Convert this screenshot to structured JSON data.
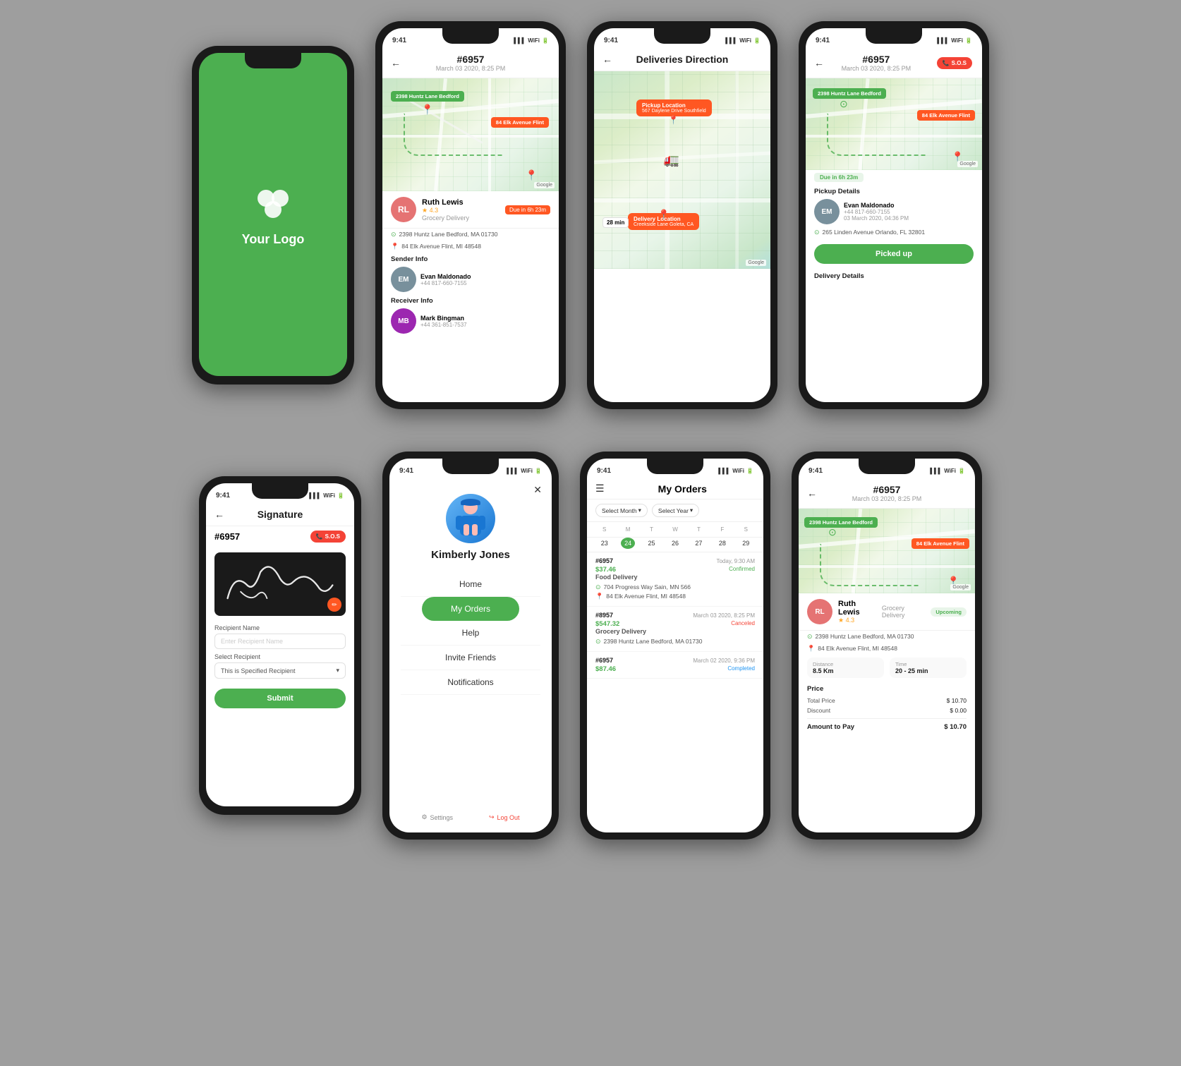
{
  "app": {
    "name": "Your Logo",
    "status_time": "9:41"
  },
  "phones": {
    "row1": [
      {
        "id": "splash",
        "type": "splash",
        "logo_text": "Your Logo"
      },
      {
        "id": "delivery-detail",
        "type": "delivery-detail",
        "order_id": "#6957",
        "date": "March 03 2020, 8:25 PM",
        "map_tag_green": "2398 Huntz Lane Bedford",
        "map_tag_orange": "84 Elk Avenue Flint",
        "courier_name": "Ruth Lewis",
        "courier_rating": "4.3",
        "courier_type": "Grocery Delivery",
        "due_label": "Due in 6h 23m",
        "address1": "2398 Huntz Lane Bedford, MA 01730",
        "address2": "84 Elk Avenue Flint, MI 48548",
        "sender_label": "Sender Info",
        "sender_name": "Evan Maldonado",
        "sender_phone": "+44 817-660-7155",
        "receiver_label": "Receiver Info",
        "receiver_name": "Mark Bingman",
        "receiver_phone": "+44 361-851-7537"
      },
      {
        "id": "deliveries-direction",
        "type": "deliveries-direction",
        "title": "Deliveries Direction",
        "pickup_label": "Pickup Location",
        "pickup_address": "567 Daylene Drive Southfield",
        "delivery_label": "Delivery Location",
        "delivery_address": "Creekside Lane Goleta, CA",
        "min_label": "28 min"
      },
      {
        "id": "delivery-detail-sos",
        "type": "delivery-detail-sos",
        "order_id": "#6957",
        "date": "March 03 2020, 8:25 PM",
        "sos_label": "S.O.S",
        "map_tag_green": "2398 Huntz Lane Bedford",
        "map_tag_orange": "84 Elk Avenue Flint",
        "due_label": "Due in 6h 23m",
        "pickup_section": "Pickup Details",
        "pickup_name": "Evan Maldonado",
        "pickup_phone": "+44 817-660-7155",
        "pickup_date": "03 March 2020, 04:36 PM",
        "pickup_address": "265 Linden Avenue Orlando, FL 32801",
        "picked_up_btn": "Picked up",
        "delivery_section": "Delivery Details"
      }
    ],
    "row2": [
      {
        "id": "signature",
        "type": "signature",
        "title": "Signature",
        "order_id": "#6957",
        "sos_label": "S.O.S",
        "recipient_label": "Recipient Name",
        "recipient_placeholder": "Enter Recipient Name",
        "select_recipient_label": "Select Recipient",
        "select_recipient_value": "This is Specified Recipient",
        "submit_btn": "Submit"
      },
      {
        "id": "menu",
        "type": "menu",
        "user_name": "Kimberly Jones",
        "menu_items": [
          "Home",
          "My Orders",
          "Help",
          "Invite Friends",
          "Notifications"
        ],
        "active_item": "My Orders",
        "settings_label": "Settings",
        "logout_label": "Log Out"
      },
      {
        "id": "orders",
        "type": "orders",
        "title": "My Orders",
        "filter_month": "Select Month",
        "filter_year": "Select Year",
        "week_days": [
          "S",
          "M",
          "T",
          "W",
          "T",
          "F",
          "S"
        ],
        "week_nums": [
          "23",
          "24",
          "25",
          "26",
          "27",
          "28",
          "29"
        ],
        "active_day": "24",
        "orders": [
          {
            "id": "#6957",
            "time": "Today, 9:30 AM",
            "price": "$37.46",
            "status": "Confirmed",
            "status_class": "confirmed",
            "type": "Food Delivery",
            "addr1": "704 Progress Way Sain, MN 566",
            "addr2": "84 Elk Avenue Flint, MI 48548"
          },
          {
            "id": "#8957",
            "time": "March 03 2020, 8:25 PM",
            "price": "$547.32",
            "status": "Canceled",
            "status_class": "canceled",
            "type": "Grocery Delivery",
            "addr1": "2398 Huntz Lane Bedford, MA 01730",
            "addr2": ""
          },
          {
            "id": "#6957",
            "time": "March 02 2020, 9:36 PM",
            "price": "$87.46",
            "status": "Completed",
            "status_class": "completed",
            "type": "",
            "addr1": "",
            "addr2": ""
          }
        ]
      },
      {
        "id": "delivery-detail-2",
        "type": "delivery-detail-2",
        "order_id": "#6957",
        "date": "March 03 2020, 8:25 PM",
        "map_tag_green": "2398 Huntz Lane Bedford",
        "map_tag_orange": "84 Elk Avenue Flint",
        "courier_name": "Ruth Lewis",
        "courier_rating": "4.3",
        "courier_type": "Grocery Delivery",
        "upcoming_label": "Upcoming",
        "address1": "2398 Huntz Lane Bedford, MA 01730",
        "address2": "84 Elk Avenue Flint, MI 48548",
        "distance_label": "Distance",
        "distance_value": "8.5 Km",
        "time_label": "Time",
        "time_value": "20 - 25 min",
        "price_label": "Price",
        "total_price_label": "Total Price",
        "total_price_value": "$ 10.70",
        "discount_label": "Discount",
        "discount_value": "$ 0.00",
        "amount_label": "Amount to Pay",
        "amount_value": "$ 10.70"
      }
    ]
  }
}
